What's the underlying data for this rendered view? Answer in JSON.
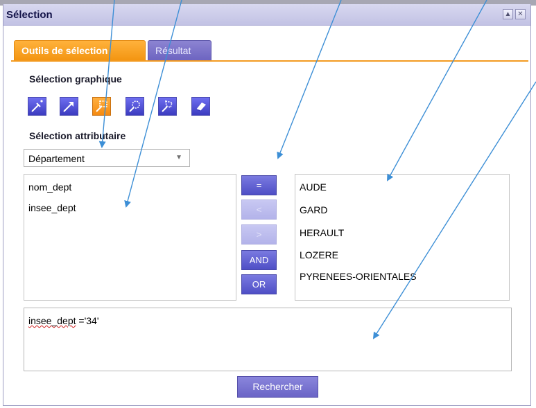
{
  "window": {
    "title": "Sélection",
    "controls": {
      "minimize_glyph": "▲",
      "close_glyph": "✕"
    }
  },
  "tabs": [
    {
      "label": "Outils de sélection",
      "active": true
    },
    {
      "label": "Résultat",
      "active": false
    }
  ],
  "graphic_selection": {
    "label": "Sélection graphique",
    "tools": [
      {
        "icon": "select-point-icon",
        "active": false
      },
      {
        "icon": "select-arrow-icon",
        "active": false
      },
      {
        "icon": "select-rectangle-icon",
        "active": true
      },
      {
        "icon": "select-circle-icon",
        "active": false
      },
      {
        "icon": "select-polygon-icon",
        "active": false
      },
      {
        "icon": "eraser-icon",
        "active": false
      }
    ]
  },
  "attribute_selection": {
    "label": "Sélection attributaire",
    "layer_dropdown": {
      "selected": "Département",
      "arrow_glyph": "▼"
    },
    "fields": [
      "nom_dept",
      "insee_dept"
    ],
    "operators": [
      {
        "label": "=",
        "enabled": true
      },
      {
        "label": "<",
        "enabled": false
      },
      {
        "label": ">",
        "enabled": false
      },
      {
        "label": "AND",
        "enabled": true
      },
      {
        "label": "OR",
        "enabled": true
      }
    ],
    "values": [
      "AUDE",
      "GARD",
      "HERAULT",
      "LOZERE",
      "PYRENEES-ORIENTALES"
    ],
    "query": {
      "field_part": "insee_dept",
      "rest": " ='34'"
    },
    "search_button": "Rechercher"
  },
  "colors": {
    "accent_orange": "#f39410",
    "button_blue": "#4f4fc6",
    "annotation_arrow": "#3d8fd6"
  }
}
